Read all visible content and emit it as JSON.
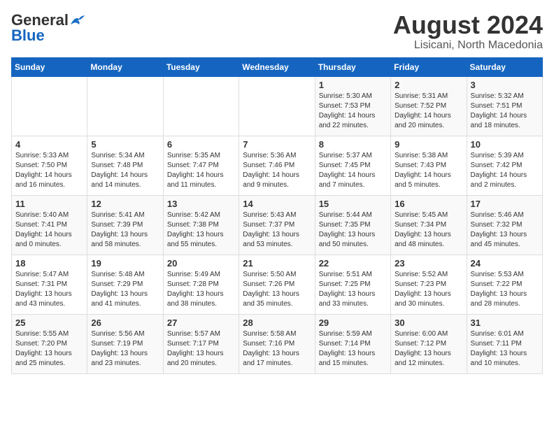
{
  "header": {
    "logo_line1": "General",
    "logo_line2": "Blue",
    "title": "August 2024",
    "subtitle": "Lisicani, North Macedonia"
  },
  "calendar": {
    "weekdays": [
      "Sunday",
      "Monday",
      "Tuesday",
      "Wednesday",
      "Thursday",
      "Friday",
      "Saturday"
    ],
    "weeks": [
      [
        {
          "day": "",
          "info": ""
        },
        {
          "day": "",
          "info": ""
        },
        {
          "day": "",
          "info": ""
        },
        {
          "day": "",
          "info": ""
        },
        {
          "day": "1",
          "info": "Sunrise: 5:30 AM\nSunset: 7:53 PM\nDaylight: 14 hours\nand 22 minutes."
        },
        {
          "day": "2",
          "info": "Sunrise: 5:31 AM\nSunset: 7:52 PM\nDaylight: 14 hours\nand 20 minutes."
        },
        {
          "day": "3",
          "info": "Sunrise: 5:32 AM\nSunset: 7:51 PM\nDaylight: 14 hours\nand 18 minutes."
        }
      ],
      [
        {
          "day": "4",
          "info": "Sunrise: 5:33 AM\nSunset: 7:50 PM\nDaylight: 14 hours\nand 16 minutes."
        },
        {
          "day": "5",
          "info": "Sunrise: 5:34 AM\nSunset: 7:48 PM\nDaylight: 14 hours\nand 14 minutes."
        },
        {
          "day": "6",
          "info": "Sunrise: 5:35 AM\nSunset: 7:47 PM\nDaylight: 14 hours\nand 11 minutes."
        },
        {
          "day": "7",
          "info": "Sunrise: 5:36 AM\nSunset: 7:46 PM\nDaylight: 14 hours\nand 9 minutes."
        },
        {
          "day": "8",
          "info": "Sunrise: 5:37 AM\nSunset: 7:45 PM\nDaylight: 14 hours\nand 7 minutes."
        },
        {
          "day": "9",
          "info": "Sunrise: 5:38 AM\nSunset: 7:43 PM\nDaylight: 14 hours\nand 5 minutes."
        },
        {
          "day": "10",
          "info": "Sunrise: 5:39 AM\nSunset: 7:42 PM\nDaylight: 14 hours\nand 2 minutes."
        }
      ],
      [
        {
          "day": "11",
          "info": "Sunrise: 5:40 AM\nSunset: 7:41 PM\nDaylight: 14 hours\nand 0 minutes."
        },
        {
          "day": "12",
          "info": "Sunrise: 5:41 AM\nSunset: 7:39 PM\nDaylight: 13 hours\nand 58 minutes."
        },
        {
          "day": "13",
          "info": "Sunrise: 5:42 AM\nSunset: 7:38 PM\nDaylight: 13 hours\nand 55 minutes."
        },
        {
          "day": "14",
          "info": "Sunrise: 5:43 AM\nSunset: 7:37 PM\nDaylight: 13 hours\nand 53 minutes."
        },
        {
          "day": "15",
          "info": "Sunrise: 5:44 AM\nSunset: 7:35 PM\nDaylight: 13 hours\nand 50 minutes."
        },
        {
          "day": "16",
          "info": "Sunrise: 5:45 AM\nSunset: 7:34 PM\nDaylight: 13 hours\nand 48 minutes."
        },
        {
          "day": "17",
          "info": "Sunrise: 5:46 AM\nSunset: 7:32 PM\nDaylight: 13 hours\nand 45 minutes."
        }
      ],
      [
        {
          "day": "18",
          "info": "Sunrise: 5:47 AM\nSunset: 7:31 PM\nDaylight: 13 hours\nand 43 minutes."
        },
        {
          "day": "19",
          "info": "Sunrise: 5:48 AM\nSunset: 7:29 PM\nDaylight: 13 hours\nand 41 minutes."
        },
        {
          "day": "20",
          "info": "Sunrise: 5:49 AM\nSunset: 7:28 PM\nDaylight: 13 hours\nand 38 minutes."
        },
        {
          "day": "21",
          "info": "Sunrise: 5:50 AM\nSunset: 7:26 PM\nDaylight: 13 hours\nand 35 minutes."
        },
        {
          "day": "22",
          "info": "Sunrise: 5:51 AM\nSunset: 7:25 PM\nDaylight: 13 hours\nand 33 minutes."
        },
        {
          "day": "23",
          "info": "Sunrise: 5:52 AM\nSunset: 7:23 PM\nDaylight: 13 hours\nand 30 minutes."
        },
        {
          "day": "24",
          "info": "Sunrise: 5:53 AM\nSunset: 7:22 PM\nDaylight: 13 hours\nand 28 minutes."
        }
      ],
      [
        {
          "day": "25",
          "info": "Sunrise: 5:55 AM\nSunset: 7:20 PM\nDaylight: 13 hours\nand 25 minutes."
        },
        {
          "day": "26",
          "info": "Sunrise: 5:56 AM\nSunset: 7:19 PM\nDaylight: 13 hours\nand 23 minutes."
        },
        {
          "day": "27",
          "info": "Sunrise: 5:57 AM\nSunset: 7:17 PM\nDaylight: 13 hours\nand 20 minutes."
        },
        {
          "day": "28",
          "info": "Sunrise: 5:58 AM\nSunset: 7:16 PM\nDaylight: 13 hours\nand 17 minutes."
        },
        {
          "day": "29",
          "info": "Sunrise: 5:59 AM\nSunset: 7:14 PM\nDaylight: 13 hours\nand 15 minutes."
        },
        {
          "day": "30",
          "info": "Sunrise: 6:00 AM\nSunset: 7:12 PM\nDaylight: 13 hours\nand 12 minutes."
        },
        {
          "day": "31",
          "info": "Sunrise: 6:01 AM\nSunset: 7:11 PM\nDaylight: 13 hours\nand 10 minutes."
        }
      ]
    ]
  }
}
